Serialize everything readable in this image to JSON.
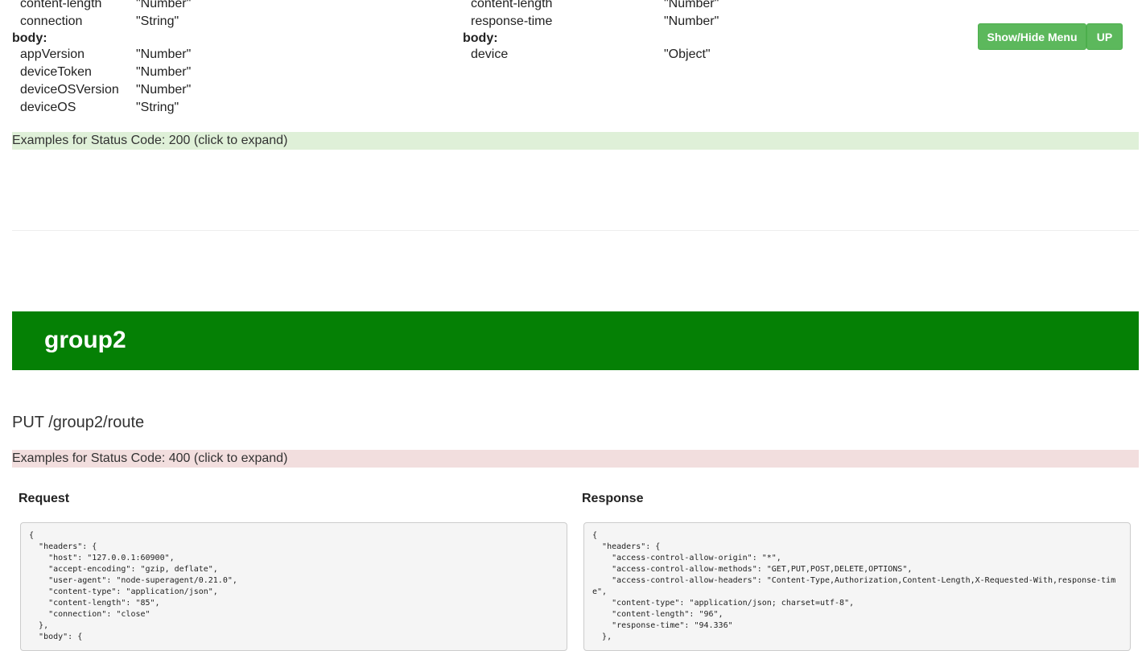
{
  "left_block": {
    "headers": [
      {
        "key": "content-length",
        "type": "\"Number\""
      },
      {
        "key": "connection",
        "type": "\"String\""
      }
    ],
    "body_label": "body:",
    "body": [
      {
        "key": "appVersion",
        "type": "\"Number\""
      },
      {
        "key": "deviceToken",
        "type": "\"Number\""
      },
      {
        "key": "deviceOSVersion",
        "type": "\"Number\""
      },
      {
        "key": "deviceOS",
        "type": "\"String\""
      }
    ]
  },
  "right_block": {
    "headers": [
      {
        "key": "content-length",
        "type": "\"Number\""
      },
      {
        "key": "response-time",
        "type": "\"Number\""
      }
    ],
    "body_label": "body:",
    "body": [
      {
        "key": "device",
        "type": "\"Object\""
      }
    ]
  },
  "toolbar": {
    "menu_label": "Show/Hide Menu",
    "up_label": "UP"
  },
  "examples_200": "Examples for Status Code: 200 (click to expand)",
  "group": {
    "title": "group2"
  },
  "route": "PUT /group2/route",
  "examples_400": "Examples for Status Code: 400 (click to expand)",
  "request": {
    "title": "Request",
    "code": "{\n  \"headers\": {\n    \"host\": \"127.0.0.1:60900\",\n    \"accept-encoding\": \"gzip, deflate\",\n    \"user-agent\": \"node-superagent/0.21.0\",\n    \"content-type\": \"application/json\",\n    \"content-length\": \"85\",\n    \"connection\": \"close\"\n  },\n  \"body\": {"
  },
  "response": {
    "title": "Response",
    "code": "{\n  \"headers\": {\n    \"access-control-allow-origin\": \"*\",\n    \"access-control-allow-methods\": \"GET,PUT,POST,DELETE,OPTIONS\",\n    \"access-control-allow-headers\": \"Content-Type,Authorization,Content-Length,X-Requested-With,response-time\",\n    \"content-type\": \"application/json; charset=utf-8\",\n    \"content-length\": \"96\",\n    \"response-time\": \"94.336\"\n  },"
  }
}
